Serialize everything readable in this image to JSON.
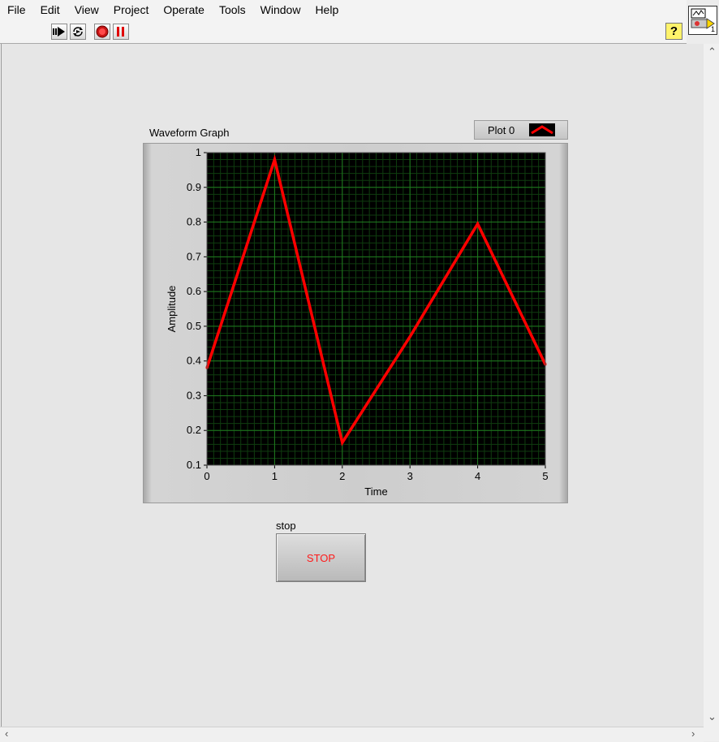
{
  "menu": [
    "File",
    "Edit",
    "View",
    "Project",
    "Operate",
    "Tools",
    "Window",
    "Help"
  ],
  "toolbar": {
    "icons": [
      "run-arrow-icon",
      "run-continuously-icon",
      "abort-icon",
      "pause-icon"
    ],
    "help_label": "?"
  },
  "vi_icon": {
    "number": "1"
  },
  "graph": {
    "label": "Waveform Graph",
    "legend_name": "Plot 0"
  },
  "chart_data": {
    "type": "line",
    "title": "",
    "xlabel": "Time",
    "ylabel": "Amplitude",
    "xlim": [
      0,
      5
    ],
    "ylim": [
      0.1,
      1
    ],
    "grid": true,
    "x_ticks": [
      "0",
      "1",
      "2",
      "3",
      "4",
      "5"
    ],
    "y_ticks": [
      "0.1",
      "0.2",
      "0.3",
      "0.4",
      "0.5",
      "0.6",
      "0.7",
      "0.8",
      "0.9",
      "1"
    ],
    "series": [
      {
        "name": "Plot 0",
        "color": "#ff0000",
        "x": [
          0,
          1,
          2,
          3,
          4,
          5
        ],
        "y": [
          0.38,
          0.98,
          0.165,
          0.47,
          0.795,
          0.39
        ]
      }
    ],
    "background": "#000000",
    "grid_major_color": "#1f7a1f",
    "grid_minor_color": "#0f3d0f"
  },
  "stop": {
    "label": "stop",
    "button_text": "STOP"
  }
}
